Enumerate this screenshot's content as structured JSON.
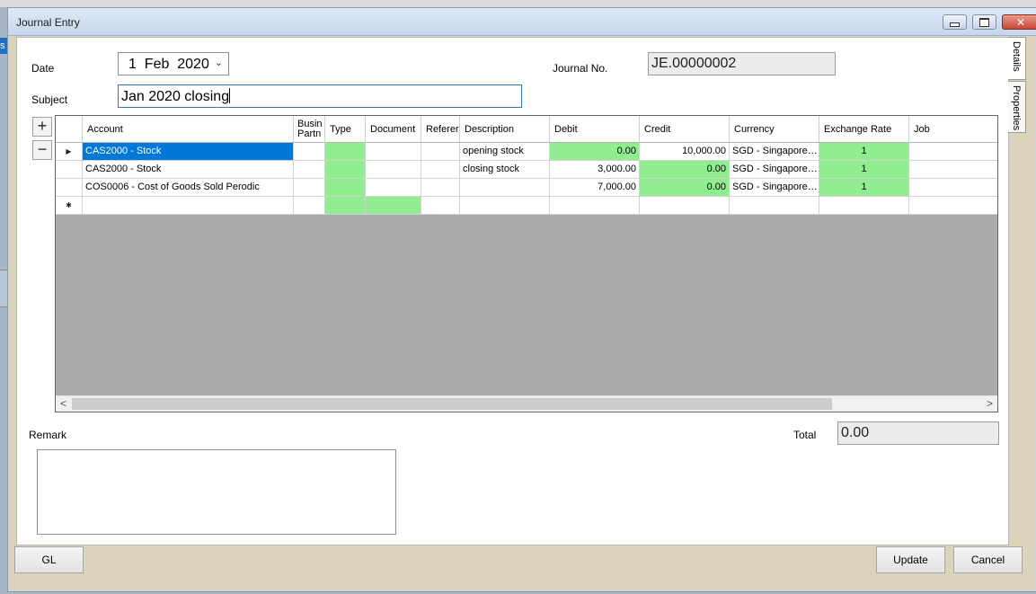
{
  "background": {
    "left_tab_text": "s"
  },
  "window": {
    "title": "Journal Entry",
    "close_glyph": "✕"
  },
  "header": {
    "date_label": "Date",
    "date_value": "1  Feb  2020",
    "date_arrow": "⌄",
    "subject_label": "Subject",
    "subject_value": "Jan 2020 closing",
    "journal_no_label": "Journal No.",
    "journal_no_value": "JE.00000002"
  },
  "grid_tools": {
    "add": "+",
    "remove": "−"
  },
  "grid": {
    "columns": [
      "Account",
      "Business Partner",
      "Type",
      "Document",
      "Reference",
      "Description",
      "Debit",
      "Credit",
      "Currency",
      "Exchange Rate",
      "Job"
    ],
    "header_display": {
      "account": "Account",
      "bp_line1": "Busin",
      "bp_line2": "Partn",
      "type": "Type",
      "document": "Document",
      "reference": "Referer",
      "description": "Description",
      "debit": "Debit",
      "credit": "Credit",
      "currency": "Currency",
      "exchange_rate": "Exchange Rate",
      "job": "Job"
    },
    "row_indicator_current": "▶",
    "row_indicator_new": "✱",
    "rows": [
      {
        "account": "CAS2000 - Stock",
        "description": "opening stock",
        "debit": "0.00",
        "credit": "10,000.00",
        "currency": "SGD - Singapore…",
        "exchange_rate": "1"
      },
      {
        "account": "CAS2000 - Stock",
        "description": "closing stock",
        "debit": "3,000.00",
        "credit": "0.00",
        "currency": "SGD - Singapore…",
        "exchange_rate": "1"
      },
      {
        "account": "COS0006 - Cost of Goods Sold Perodic",
        "description": "",
        "debit": "7,000.00",
        "credit": "0.00",
        "currency": "SGD - Singapore…",
        "exchange_rate": "1"
      }
    ],
    "scroll_left": "<",
    "scroll_right": ">"
  },
  "footer": {
    "remark_label": "Remark",
    "total_label": "Total",
    "total_value": "0.00"
  },
  "side_tabs": {
    "details": "Details",
    "properties": "Properties"
  },
  "buttons": {
    "gl": "GL",
    "update": "Update",
    "cancel": "Cancel"
  },
  "colors": {
    "editable_cell": "#90ee90",
    "selection": "#0078d7",
    "grid_empty": "#ababab"
  }
}
